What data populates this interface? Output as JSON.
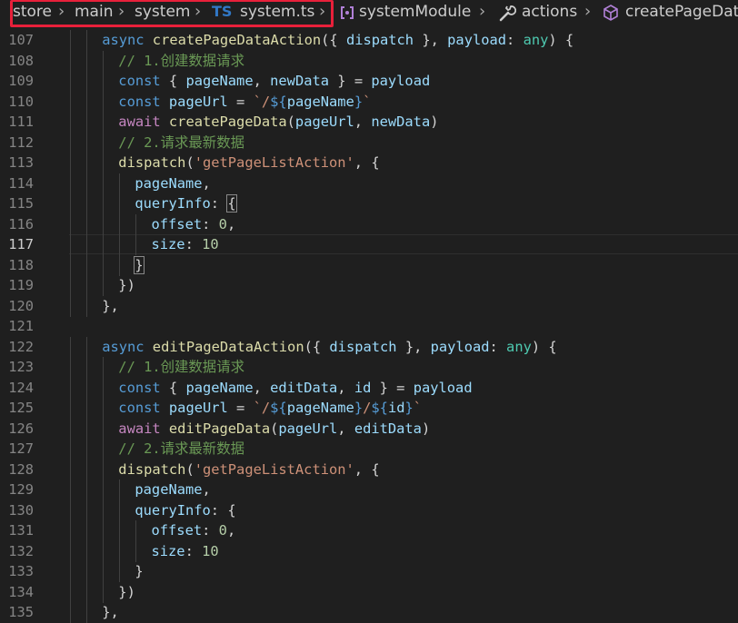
{
  "breadcrumb": {
    "segments": [
      "store",
      "main",
      "system",
      "TS",
      "system.ts",
      "systemModule",
      "actions",
      "createPageDat"
    ]
  },
  "editor": {
    "language": "typescript",
    "active_line": 117,
    "lines": [
      {
        "n": "107",
        "indent": 2,
        "tokens": [
          [
            "kw",
            "async "
          ],
          [
            "fn",
            "createPageDataAction"
          ],
          [
            "punc",
            "({ "
          ],
          [
            "var",
            "dispatch"
          ],
          [
            "punc",
            " }, "
          ],
          [
            "var",
            "payload"
          ],
          [
            "punc",
            ": "
          ],
          [
            "type",
            "any"
          ],
          [
            "punc",
            ") {"
          ]
        ]
      },
      {
        "n": "108",
        "indent": 3,
        "tokens": [
          [
            "cmt",
            "// 1.创建数据请求"
          ]
        ]
      },
      {
        "n": "109",
        "indent": 3,
        "tokens": [
          [
            "kw",
            "const "
          ],
          [
            "punc",
            "{ "
          ],
          [
            "var",
            "pageName"
          ],
          [
            "punc",
            ", "
          ],
          [
            "var",
            "newData"
          ],
          [
            "punc",
            " } = "
          ],
          [
            "var",
            "payload"
          ]
        ]
      },
      {
        "n": "110",
        "indent": 3,
        "tokens": [
          [
            "kw",
            "const "
          ],
          [
            "var",
            "pageUrl"
          ],
          [
            "punc",
            " = "
          ],
          [
            "str",
            "`/"
          ],
          [
            "kw",
            "${"
          ],
          [
            "var",
            "pageName"
          ],
          [
            "kw",
            "}"
          ],
          [
            "str",
            "`"
          ]
        ]
      },
      {
        "n": "111",
        "indent": 3,
        "tokens": [
          [
            "ctrl",
            "await "
          ],
          [
            "fn",
            "createPageData"
          ],
          [
            "punc",
            "("
          ],
          [
            "var",
            "pageUrl"
          ],
          [
            "punc",
            ", "
          ],
          [
            "var",
            "newData"
          ],
          [
            "punc",
            ")"
          ]
        ]
      },
      {
        "n": "112",
        "indent": 3,
        "tokens": [
          [
            "cmt",
            "// 2.请求最新数据"
          ]
        ]
      },
      {
        "n": "113",
        "indent": 3,
        "tokens": [
          [
            "fn",
            "dispatch"
          ],
          [
            "punc",
            "("
          ],
          [
            "str",
            "'getPageListAction'"
          ],
          [
            "punc",
            ", {"
          ]
        ]
      },
      {
        "n": "114",
        "indent": 4,
        "tokens": [
          [
            "var",
            "pageName"
          ],
          [
            "punc",
            ","
          ]
        ]
      },
      {
        "n": "115",
        "indent": 4,
        "tokens": [
          [
            "var",
            "queryInfo"
          ],
          [
            "punc",
            ": "
          ],
          [
            "bracket",
            "{"
          ]
        ]
      },
      {
        "n": "116",
        "indent": 5,
        "tokens": [
          [
            "var",
            "offset"
          ],
          [
            "punc",
            ": "
          ],
          [
            "num",
            "0"
          ],
          [
            "punc",
            ","
          ]
        ]
      },
      {
        "n": "117",
        "indent": 5,
        "tokens": [
          [
            "var",
            "size"
          ],
          [
            "punc",
            ": "
          ],
          [
            "num",
            "10"
          ]
        ]
      },
      {
        "n": "118",
        "indent": 4,
        "tokens": [
          [
            "bracket",
            "}"
          ]
        ]
      },
      {
        "n": "119",
        "indent": 3,
        "tokens": [
          [
            "punc",
            "})"
          ]
        ]
      },
      {
        "n": "120",
        "indent": 2,
        "tokens": [
          [
            "punc",
            "},"
          ]
        ]
      },
      {
        "n": "121",
        "indent": 0,
        "tokens": []
      },
      {
        "n": "122",
        "indent": 2,
        "tokens": [
          [
            "kw",
            "async "
          ],
          [
            "fn",
            "editPageDataAction"
          ],
          [
            "punc",
            "({ "
          ],
          [
            "var",
            "dispatch"
          ],
          [
            "punc",
            " }, "
          ],
          [
            "var",
            "payload"
          ],
          [
            "punc",
            ": "
          ],
          [
            "type",
            "any"
          ],
          [
            "punc",
            ") {"
          ]
        ]
      },
      {
        "n": "123",
        "indent": 3,
        "tokens": [
          [
            "cmt",
            "// 1.创建数据请求"
          ]
        ]
      },
      {
        "n": "124",
        "indent": 3,
        "tokens": [
          [
            "kw",
            "const "
          ],
          [
            "punc",
            "{ "
          ],
          [
            "var",
            "pageName"
          ],
          [
            "punc",
            ", "
          ],
          [
            "var",
            "editData"
          ],
          [
            "punc",
            ", "
          ],
          [
            "var",
            "id"
          ],
          [
            "punc",
            " } = "
          ],
          [
            "var",
            "payload"
          ]
        ]
      },
      {
        "n": "125",
        "indent": 3,
        "tokens": [
          [
            "kw",
            "const "
          ],
          [
            "var",
            "pageUrl"
          ],
          [
            "punc",
            " = "
          ],
          [
            "str",
            "`/"
          ],
          [
            "kw",
            "${"
          ],
          [
            "var",
            "pageName"
          ],
          [
            "kw",
            "}"
          ],
          [
            "str",
            "/"
          ],
          [
            "kw",
            "${"
          ],
          [
            "var",
            "id"
          ],
          [
            "kw",
            "}"
          ],
          [
            "str",
            "`"
          ]
        ]
      },
      {
        "n": "126",
        "indent": 3,
        "tokens": [
          [
            "ctrl",
            "await "
          ],
          [
            "fn",
            "editPageData"
          ],
          [
            "punc",
            "("
          ],
          [
            "var",
            "pageUrl"
          ],
          [
            "punc",
            ", "
          ],
          [
            "var",
            "editData"
          ],
          [
            "punc",
            ")"
          ]
        ]
      },
      {
        "n": "127",
        "indent": 3,
        "tokens": [
          [
            "cmt",
            "// 2.请求最新数据"
          ]
        ]
      },
      {
        "n": "128",
        "indent": 3,
        "tokens": [
          [
            "fn",
            "dispatch"
          ],
          [
            "punc",
            "("
          ],
          [
            "str",
            "'getPageListAction'"
          ],
          [
            "punc",
            ", {"
          ]
        ]
      },
      {
        "n": "129",
        "indent": 4,
        "tokens": [
          [
            "var",
            "pageName"
          ],
          [
            "punc",
            ","
          ]
        ]
      },
      {
        "n": "130",
        "indent": 4,
        "tokens": [
          [
            "var",
            "queryInfo"
          ],
          [
            "punc",
            ": {"
          ]
        ]
      },
      {
        "n": "131",
        "indent": 5,
        "tokens": [
          [
            "var",
            "offset"
          ],
          [
            "punc",
            ": "
          ],
          [
            "num",
            "0"
          ],
          [
            "punc",
            ","
          ]
        ]
      },
      {
        "n": "132",
        "indent": 5,
        "tokens": [
          [
            "var",
            "size"
          ],
          [
            "punc",
            ": "
          ],
          [
            "num",
            "10"
          ]
        ]
      },
      {
        "n": "133",
        "indent": 4,
        "tokens": [
          [
            "punc",
            "}"
          ]
        ]
      },
      {
        "n": "134",
        "indent": 3,
        "tokens": [
          [
            "punc",
            "})"
          ]
        ]
      },
      {
        "n": "135",
        "indent": 2,
        "tokens": [
          [
            "punc",
            "},"
          ]
        ]
      }
    ]
  }
}
